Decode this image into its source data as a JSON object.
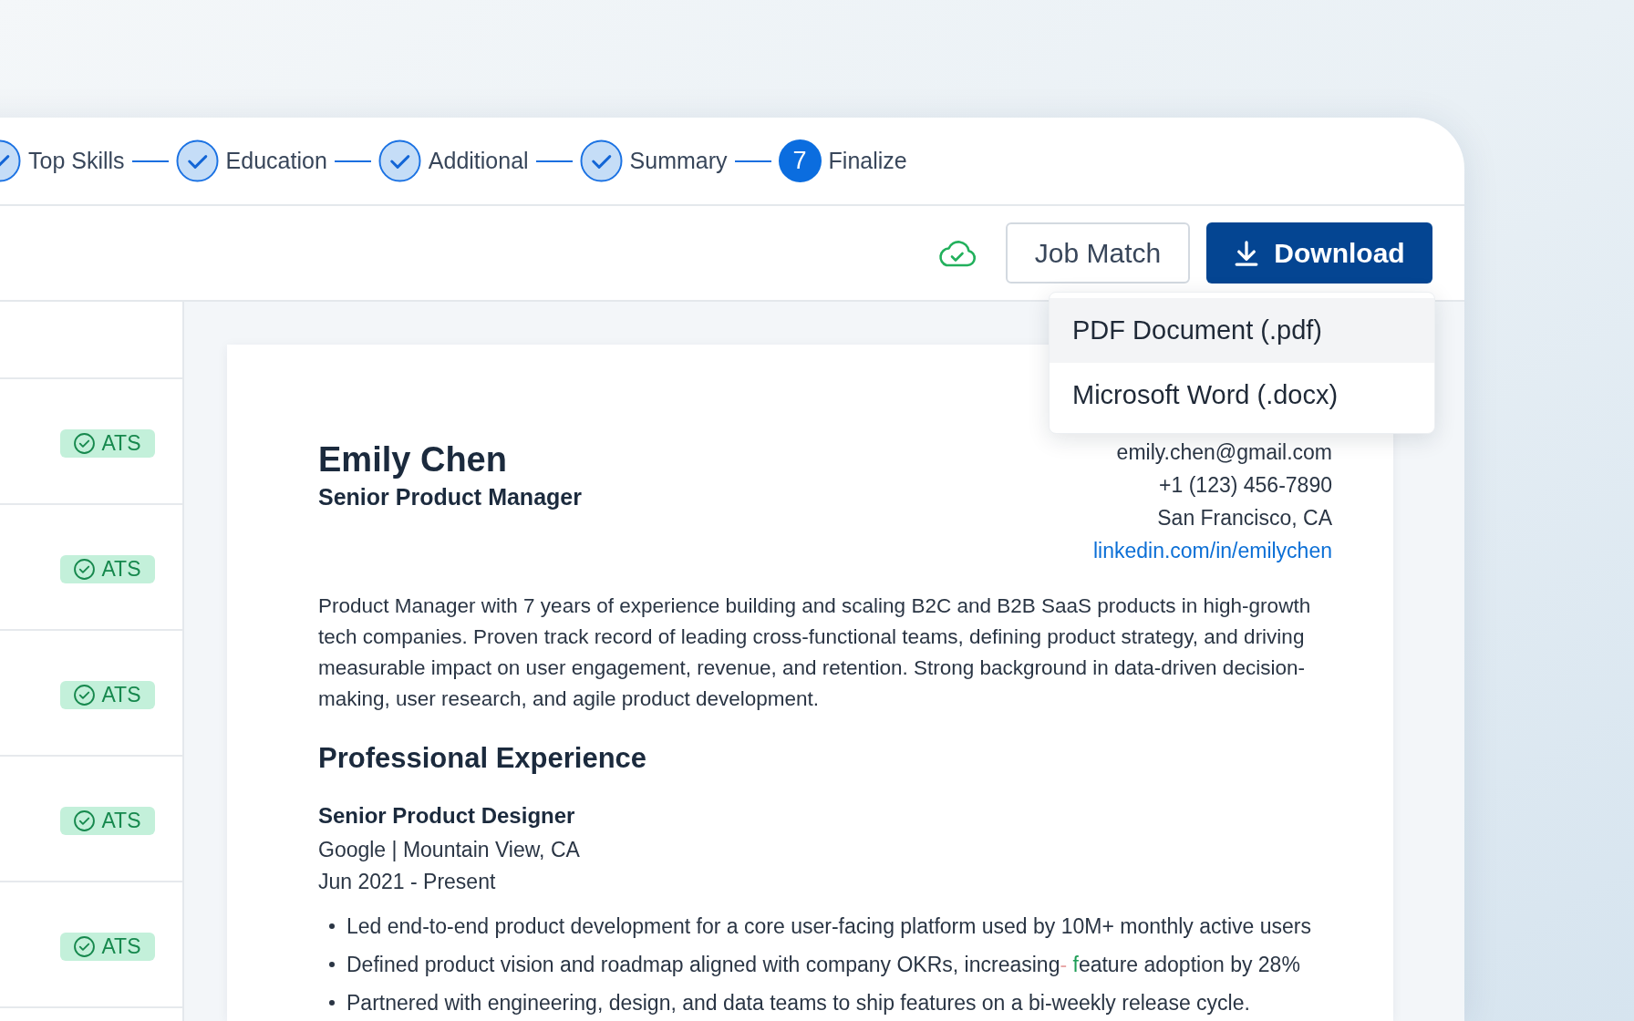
{
  "stepper": {
    "steps": [
      {
        "label": "Top Skills",
        "completed": true
      },
      {
        "label": "Education",
        "completed": true
      },
      {
        "label": "Additional",
        "completed": true
      },
      {
        "label": "Summary",
        "completed": true
      },
      {
        "label": "Finalize",
        "completed": false,
        "number": "7"
      }
    ]
  },
  "toolbar": {
    "job_match_button": "Job Match",
    "download_button": "Download",
    "download_menu": [
      {
        "label": "PDF Document (.pdf)",
        "selected": true
      },
      {
        "label": "Microsoft Word (.docx)",
        "selected": false
      }
    ]
  },
  "sidebar": {
    "items": [
      {
        "badge": "ATS"
      },
      {
        "badge": "ATS"
      },
      {
        "badge": "ATS"
      },
      {
        "badge": "ATS"
      },
      {
        "badge": "ATS"
      }
    ]
  },
  "resume": {
    "name": "Emily Chen",
    "title": "Senior Product Manager",
    "contact": [
      {
        "text": "emily.chen@gmail.com",
        "kind": "text"
      },
      {
        "text": "+1 (123) 456-7890",
        "kind": "text"
      },
      {
        "text": "San Francisco, CA",
        "kind": "text"
      },
      {
        "text": "linkedin.com/in/emilychen",
        "kind": "link"
      }
    ],
    "summary": "Product Manager with 7 years of experience building and scaling B2C and B2B SaaS products in high-growth tech companies. Proven track record of leading cross-functional teams, defining product strategy, and driving measurable impact on user engagement, revenue, and retention. Strong background in data-driven decision-making, user research, and agile product development.",
    "sections": [
      {
        "heading": "Professional Experience",
        "entries": [
          {
            "role": "Senior Product Designer",
            "company": "Google | Mountain View, CA",
            "dates": "Jun 2021 - Present",
            "bullets": [
              {
                "segments": [
                  {
                    "text": "Led end-to-end product development for a core user-facing platform used by 10M+ monthly active users",
                    "kind": "plain"
                  }
                ]
              },
              {
                "segments": [
                  {
                    "text": "Defined product vision and roadmap aligned with company OKRs, increasing",
                    "kind": "plain"
                  },
                  {
                    "text": "-",
                    "kind": "removed"
                  },
                  {
                    "text": " f",
                    "kind": "added"
                  },
                  {
                    "text": "eature adoption by 28%",
                    "kind": "plain"
                  }
                ]
              },
              {
                "segments": [
                  {
                    "text": "Partnered with engineering, design, and data teams to ship features on a bi-weekly release cycle.",
                    "kind": "plain"
                  }
                ]
              }
            ]
          }
        ]
      }
    ]
  }
}
